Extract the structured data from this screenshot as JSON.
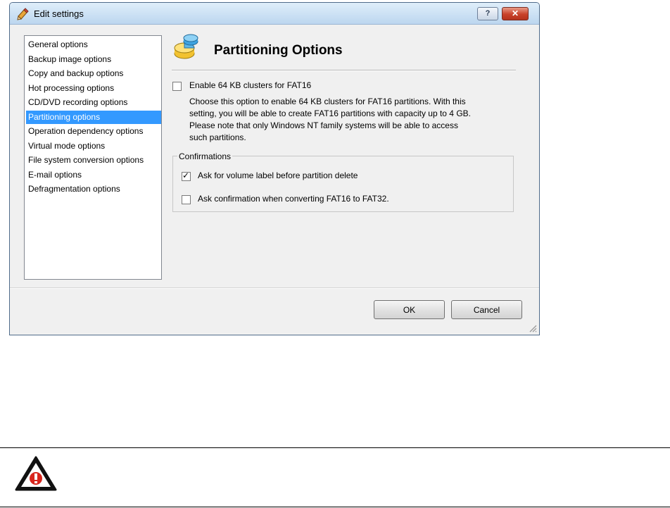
{
  "window": {
    "title": "Edit settings",
    "help_label": "?",
    "close_label": "✕"
  },
  "nav": {
    "items": [
      {
        "label": "General options"
      },
      {
        "label": "Backup image options"
      },
      {
        "label": "Copy and backup options"
      },
      {
        "label": "Hot processing options"
      },
      {
        "label": "CD/DVD recording options"
      },
      {
        "label": "Partitioning options"
      },
      {
        "label": "Operation dependency options"
      },
      {
        "label": "Virtual mode options"
      },
      {
        "label": "File system conversion options"
      },
      {
        "label": "E-mail options"
      },
      {
        "label": "Defragmentation options"
      }
    ],
    "selected_index": 5
  },
  "panel": {
    "title": "Partitioning Options",
    "enable_64kb": {
      "label": "Enable 64 KB clusters for FAT16",
      "checked": false,
      "description_lines": [
        "Choose this option to enable 64 KB clusters for FAT16 partitions. With this",
        "setting, you will be able to create FAT16 partitions with capacity up to 4 GB.",
        "Please note that only Windows NT family systems will be able to access",
        "such partitions."
      ]
    },
    "confirmations": {
      "title": "Confirmations",
      "volume_label": {
        "label": "Ask for volume label before partition delete",
        "checked": true
      },
      "convert_fat": {
        "label": "Ask confirmation when converting FAT16 to FAT32.",
        "checked": false
      }
    }
  },
  "buttons": {
    "ok": "OK",
    "cancel": "Cancel"
  },
  "icons": {
    "title": "settings-pencil-icon",
    "header": "partition-disk-icon",
    "warning": "warning-triangle-icon"
  },
  "colors": {
    "selection": "#3399ff",
    "close_button": "#c8412a",
    "warning_red": "#d8261d"
  }
}
